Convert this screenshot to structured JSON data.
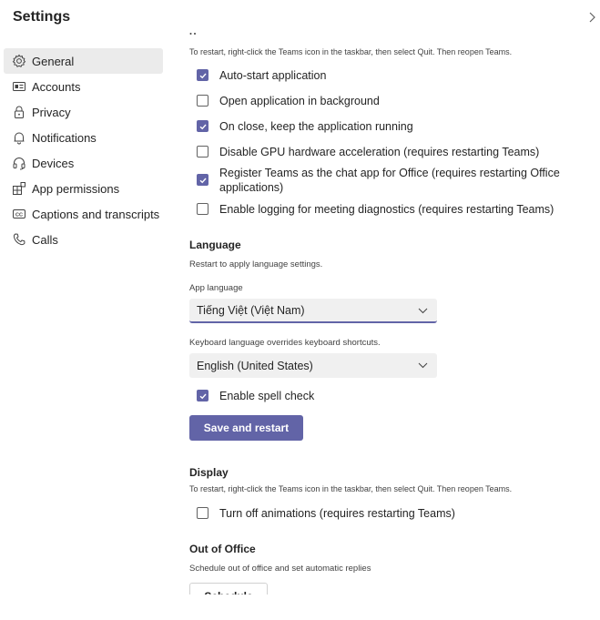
{
  "header": {
    "title": "Settings"
  },
  "sidebar": {
    "items": [
      {
        "label": "General",
        "icon": "gear-icon",
        "active": true
      },
      {
        "label": "Accounts",
        "icon": "id-card-icon",
        "active": false
      },
      {
        "label": "Privacy",
        "icon": "lock-icon",
        "active": false
      },
      {
        "label": "Notifications",
        "icon": "bell-icon",
        "active": false
      },
      {
        "label": "Devices",
        "icon": "headset-icon",
        "active": false
      },
      {
        "label": "App permissions",
        "icon": "apps-icon",
        "active": false
      },
      {
        "label": "Captions and transcripts",
        "icon": "cc-icon",
        "active": false
      },
      {
        "label": "Calls",
        "icon": "phone-icon",
        "active": false
      }
    ]
  },
  "application": {
    "restart_hint": "To restart, right-click the Teams icon in the taskbar, then select Quit. Then reopen Teams.",
    "options": [
      {
        "label": "Auto-start application",
        "checked": true
      },
      {
        "label": "Open application in background",
        "checked": false
      },
      {
        "label": "On close, keep the application running",
        "checked": true
      },
      {
        "label": "Disable GPU hardware acceleration (requires restarting Teams)",
        "checked": false
      },
      {
        "label": "Register Teams as the chat app for Office (requires restarting Office applications)",
        "checked": true
      },
      {
        "label": "Enable logging for meeting diagnostics (requires restarting Teams)",
        "checked": false
      }
    ]
  },
  "language": {
    "title": "Language",
    "restart_note": "Restart to apply language settings.",
    "app_language_label": "App language",
    "app_language_value": "Tiếng Việt (Việt Nam)",
    "keyboard_note": "Keyboard language overrides keyboard shortcuts.",
    "keyboard_language_value": "English (United States)",
    "spell_check": {
      "label": "Enable spell check",
      "checked": true
    },
    "save_button": "Save and restart"
  },
  "display": {
    "title": "Display",
    "restart_hint": "To restart, right-click the Teams icon in the taskbar, then select Quit. Then reopen Teams.",
    "animations": {
      "label": "Turn off animations (requires restarting Teams)",
      "checked": false
    }
  },
  "out_of_office": {
    "title": "Out of Office",
    "description": "Schedule out of office and set automatic replies",
    "button": "Schedule"
  },
  "colors": {
    "accent": "#6264a7",
    "nav_active_bg": "#ebebeb",
    "dropdown_bg": "#f0f0f0"
  }
}
